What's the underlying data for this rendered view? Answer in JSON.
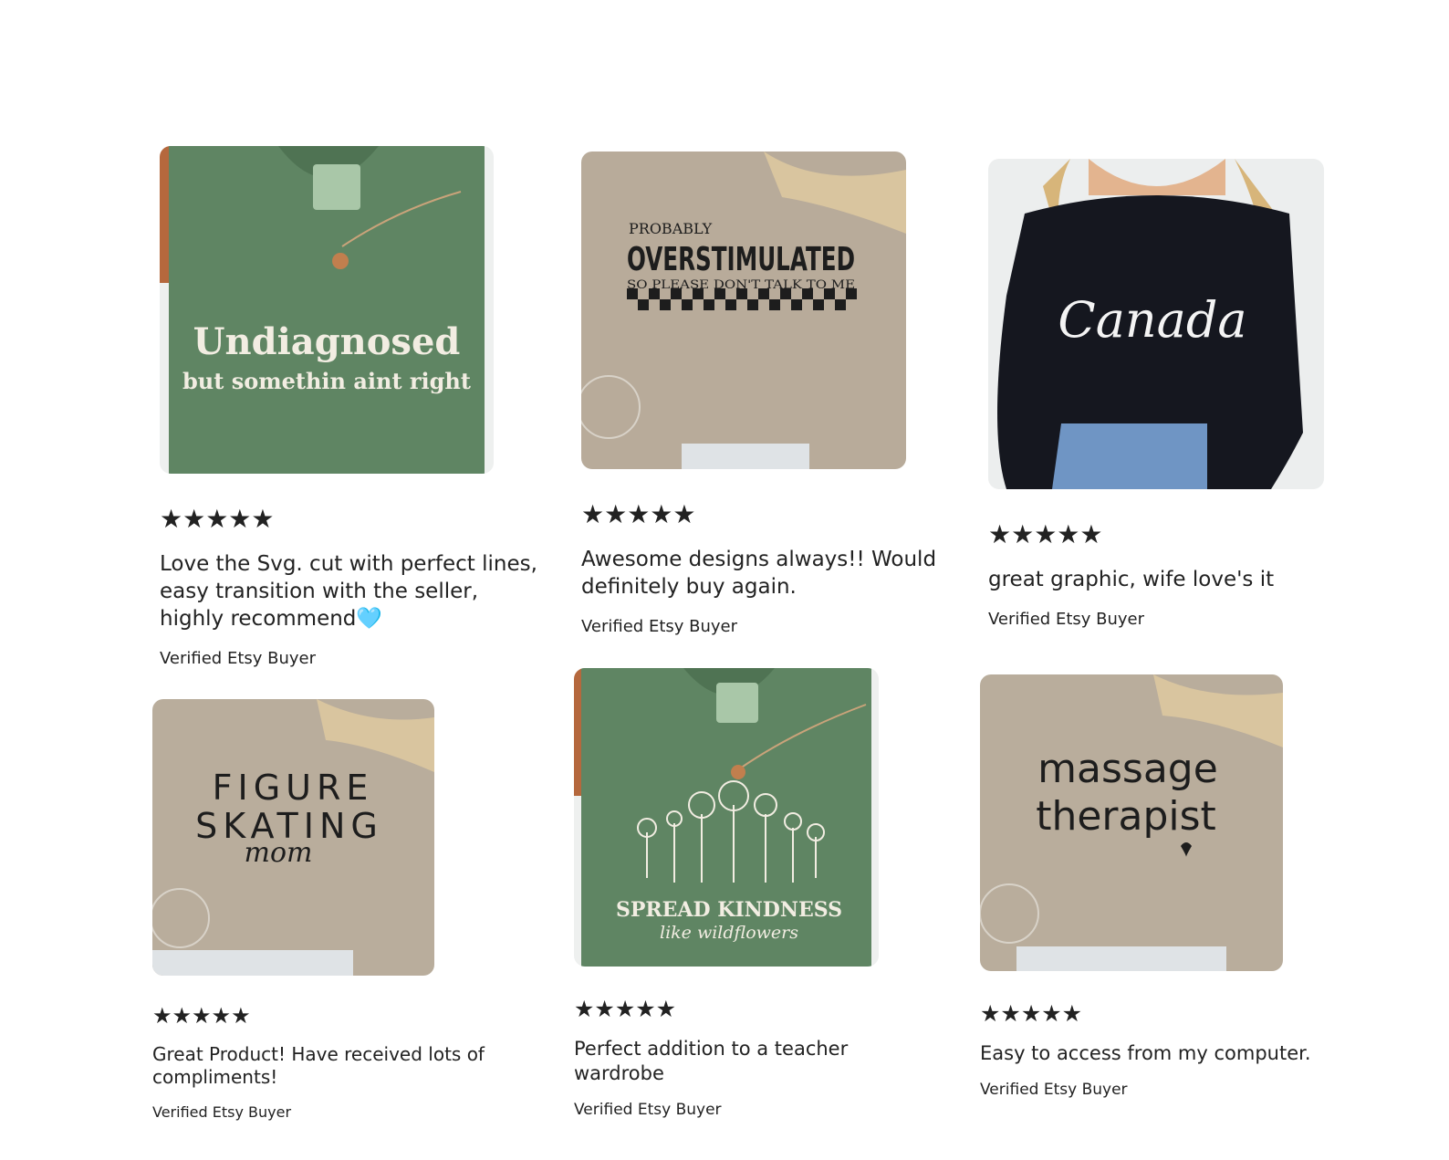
{
  "reviews": [
    {
      "stars": "★★★★★",
      "rating": 5,
      "text": "Love the Svg. cut with perfect lines, easy transition with the seller, highly recommend🩵",
      "buyer": "Verified Etsy Buyer",
      "image": {
        "product": "green comfort colors t-shirt",
        "color": "#5f8563",
        "line1": "Undiagnosed",
        "line2": "but somethin aint right"
      }
    },
    {
      "stars": "★★★★★",
      "rating": 5,
      "text": "Awesome designs always!!  Would definitely buy again.",
      "buyer": "Verified Etsy Buyer",
      "image": {
        "product": "sand sweatshirt",
        "color": "#b8ab9a",
        "line1": "PROBABLY",
        "line2": "OVERSTIMULATED",
        "line3": "SO PLEASE DON'T TALK TO ME"
      }
    },
    {
      "stars": "★★★★★",
      "rating": 5,
      "text": "great graphic, wife love's it",
      "buyer": "Verified Etsy Buyer",
      "image": {
        "product": "black sweatshirt",
        "color": "#15171f",
        "line1": "Canada"
      }
    },
    {
      "stars": "★★★★★",
      "rating": 5,
      "text": "Great Product! Have received lots of compliments!",
      "buyer": "Verified Etsy Buyer",
      "image": {
        "product": "sand sweatshirt",
        "color": "#b9ad9c",
        "line1": "FIGURE",
        "line2": "SKATING",
        "line3": "mom"
      }
    },
    {
      "stars": "★★★★★",
      "rating": 5,
      "text": "Perfect addition to a teacher wardrobe",
      "buyer": "Verified Etsy Buyer",
      "image": {
        "product": "green comfort colors t-shirt",
        "color": "#5f8563",
        "line1": "SPREAD KINDNESS",
        "line2": "like wildflowers"
      }
    },
    {
      "stars": "★★★★★",
      "rating": 5,
      "text": "Easy to access from my computer.",
      "buyer": "Verified Etsy Buyer",
      "image": {
        "product": "sand sweatshirt",
        "color": "#b9ad9c",
        "line1": "massage",
        "line2": "therapist"
      }
    }
  ],
  "colors": {
    "text": "#222222",
    "background": "#ffffff"
  }
}
